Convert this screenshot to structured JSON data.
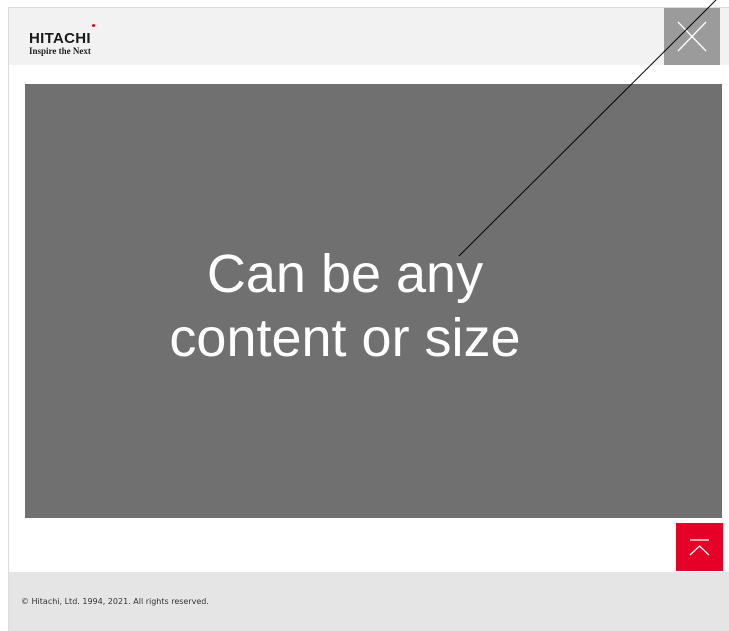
{
  "header": {
    "logo_name": "HITACHI",
    "logo_tagline": "Inspire the Next",
    "close_icon": "close-icon"
  },
  "main": {
    "placeholder_text": "Can be any\ncontent or size"
  },
  "actions": {
    "back_to_top_icon": "chevron-up-icon"
  },
  "footer": {
    "copyright": "© Hitachi, Ltd. 1994, 2021. All rights reserved."
  },
  "colors": {
    "header_bg": "#f2f2f2",
    "close_bg": "#9b9b9b",
    "content_bg": "#707070",
    "accent_red": "#e60027",
    "footer_bg": "#e5e5e5"
  }
}
